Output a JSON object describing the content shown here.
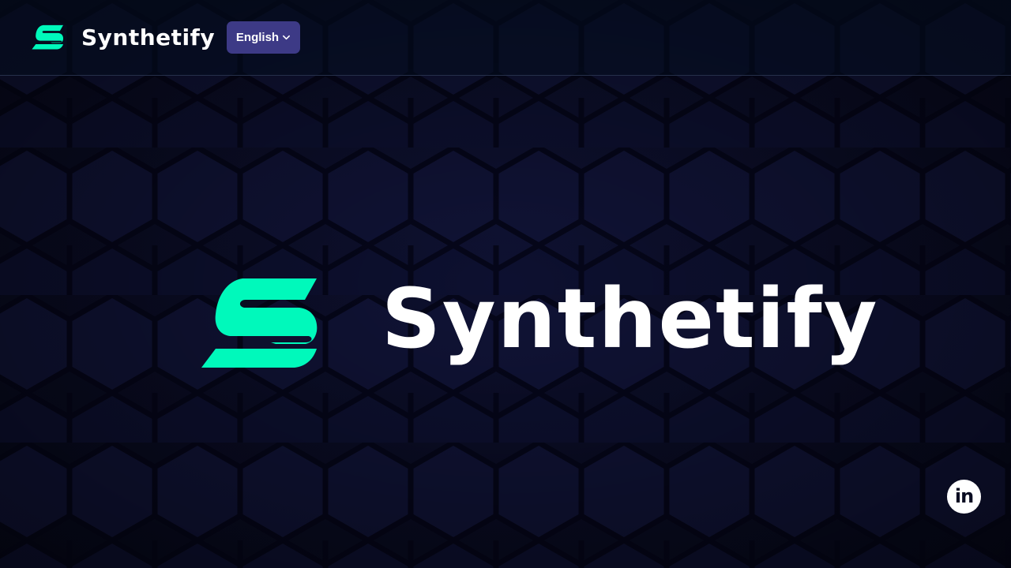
{
  "header": {
    "brand_name": "Synthetify",
    "language_button": {
      "label": "English",
      "icon": "chevron-down-icon"
    }
  },
  "hero": {
    "brand_name": "Synthetify",
    "logo_icon": "synthetify-logo-icon"
  },
  "footer": {
    "social": [
      {
        "name": "linkedin",
        "label": "in",
        "icon": "linkedin-icon"
      }
    ]
  },
  "colors": {
    "background": "#0a0c22",
    "accent": "#00f9bb",
    "language_button": "#3d3a86",
    "text": "#ffffff"
  }
}
